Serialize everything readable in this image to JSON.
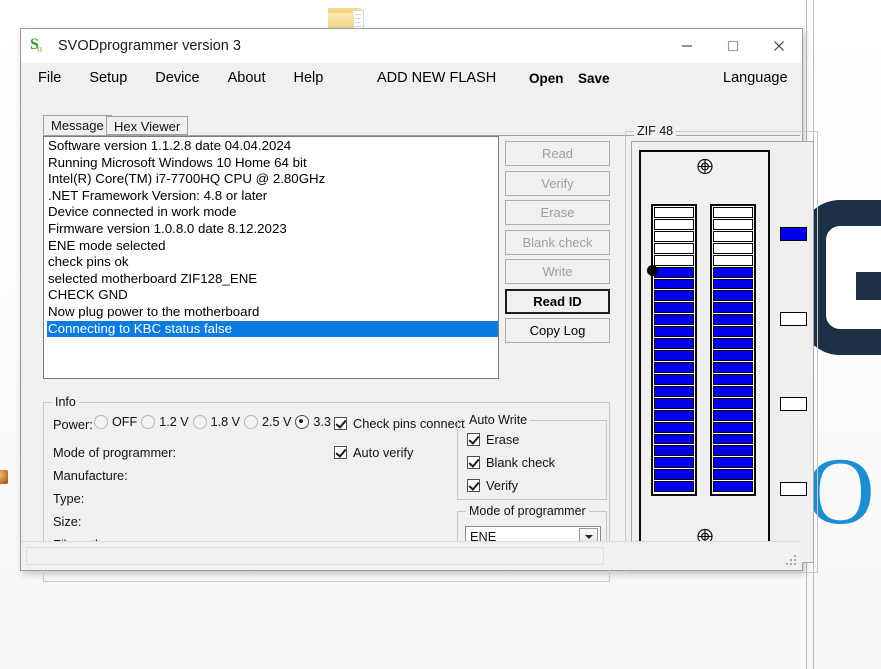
{
  "window": {
    "title": "SVODprogrammer version 3",
    "app_icon": "s-logo-icon",
    "minimize_label": "minimize-icon",
    "maximize_label": "maximize-icon",
    "close_label": "close-icon"
  },
  "menubar": {
    "items": [
      "File",
      "Setup",
      "Device",
      "About",
      "Help"
    ],
    "add_new_flash": "ADD NEW FLASH",
    "open": "Open",
    "save": "Save",
    "language": "Language"
  },
  "tabs": [
    {
      "label": "Message",
      "active": true
    },
    {
      "label": "Hex Viewer",
      "active": false
    }
  ],
  "log": {
    "lines": [
      {
        "text": "Software version 1.1.2.8 date 04.04.2024",
        "selected": false
      },
      {
        "text": "Running Microsoft Windows 10 Home 64 bit",
        "selected": false
      },
      {
        "text": "Intel(R) Core(TM) i7-7700HQ CPU @ 2.80GHz",
        "selected": false
      },
      {
        "text": ".NET Framework Version: 4.8 or later",
        "selected": false
      },
      {
        "text": "Device connected in work mode",
        "selected": false
      },
      {
        "text": "Firmware version 1.0.8.0 date 8.12.2023",
        "selected": false
      },
      {
        "text": "ENE mode selected",
        "selected": false
      },
      {
        "text": "check pins ok",
        "selected": false
      },
      {
        "text": "selected motherboard ZIF128_ENE",
        "selected": false
      },
      {
        "text": "CHECK GND",
        "selected": false
      },
      {
        "text": "Now plug power to the motherboard",
        "selected": false
      },
      {
        "text": "Connecting to KBC status false",
        "selected": true
      }
    ],
    "selection_color": "#0a7ce0"
  },
  "actions": {
    "buttons": [
      {
        "label": "Read",
        "enabled": false
      },
      {
        "label": "Verify",
        "enabled": false
      },
      {
        "label": "Erase",
        "enabled": false
      },
      {
        "label": "Blank check",
        "enabled": false
      },
      {
        "label": "Write",
        "enabled": false
      },
      {
        "label": "Read ID",
        "enabled": true
      }
    ],
    "copy_log": "Copy Log"
  },
  "info": {
    "legend": "Info",
    "power_label": "Power:",
    "power_options": [
      {
        "label": "OFF",
        "selected": false
      },
      {
        "label": "1.2 V",
        "selected": false
      },
      {
        "label": "1.8 V",
        "selected": false
      },
      {
        "label": "2.5 V",
        "selected": false
      },
      {
        "label": "3.3 V",
        "selected": true
      }
    ],
    "check_pins_connect": {
      "label": "Check pins connect",
      "checked": true
    },
    "auto_verify": {
      "label": "Auto verify",
      "checked": true
    },
    "fields": [
      {
        "label": "Mode of programmer:",
        "value": ""
      },
      {
        "label": "Manufacture:",
        "value": ""
      },
      {
        "label": "Type:",
        "value": ""
      },
      {
        "label": "Size:",
        "value": ""
      },
      {
        "label": "File path:",
        "value": ""
      }
    ]
  },
  "auto_write": {
    "legend": "Auto Write",
    "items": [
      {
        "label": "Erase",
        "checked": true
      },
      {
        "label": "Blank check",
        "checked": true
      },
      {
        "label": "Verify",
        "checked": true
      }
    ]
  },
  "mode_of_programmer": {
    "legend": "Mode of programmer",
    "selected": "ENE",
    "options": [
      "ENE"
    ]
  },
  "zif": {
    "legend": "ZIF 48",
    "pins_per_column": 24,
    "columns": [
      {
        "name": "left",
        "states": [
          false,
          false,
          false,
          false,
          false,
          true,
          true,
          true,
          true,
          true,
          true,
          true,
          true,
          true,
          true,
          true,
          true,
          true,
          true,
          true,
          true,
          true,
          true,
          true
        ]
      },
      {
        "name": "right",
        "states": [
          false,
          false,
          false,
          false,
          false,
          true,
          true,
          true,
          true,
          true,
          true,
          true,
          true,
          true,
          true,
          true,
          true,
          true,
          true,
          true,
          true,
          true,
          true,
          true
        ]
      }
    ],
    "indicators": [
      {
        "on": true
      },
      {
        "on": false
      },
      {
        "on": false
      },
      {
        "on": false
      }
    ],
    "pin_on_color": "#0000ee",
    "pin_off_color": "#ffffff",
    "marker": "pin1-marker"
  },
  "statusbar": {
    "text": ""
  },
  "desktop": {
    "folder_icon": "folder-icon",
    "logo_shape": "rounded-c-logo",
    "logo_letter": "O",
    "logo_dark_color": "#1c3046",
    "logo_blue_color": "#1a8ed1"
  }
}
